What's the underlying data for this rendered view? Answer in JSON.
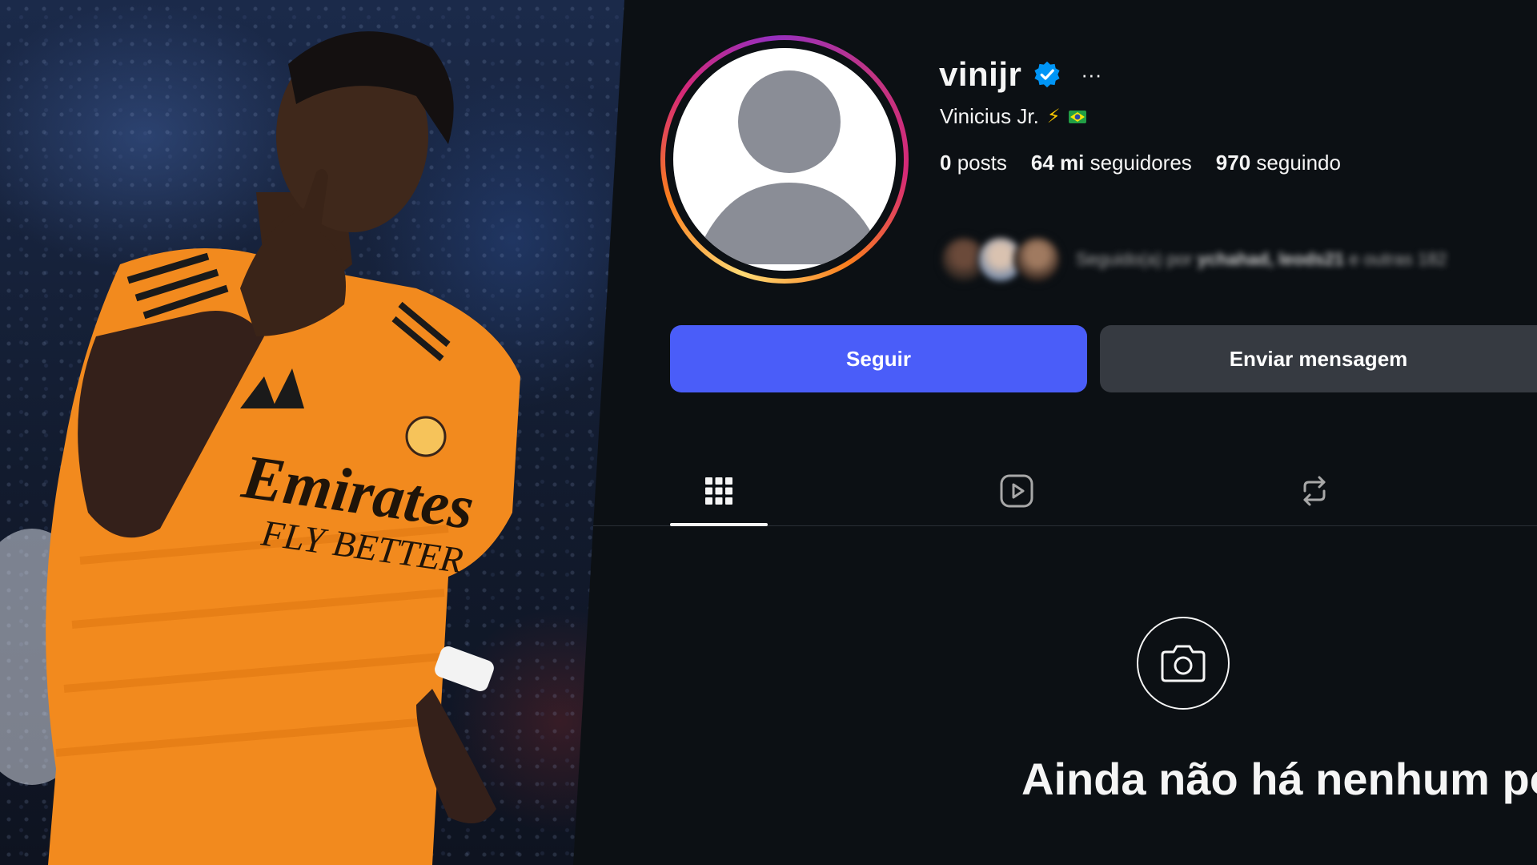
{
  "photo": {
    "icon": "player-photo",
    "shirt_sponsor_line1": "Emirates",
    "shirt_sponsor_line2": "FLY BETTER"
  },
  "profile": {
    "username": "vinijr",
    "verified_icon": "verified-badge-icon",
    "more_label": "···",
    "full_name": "Vinicius Jr.",
    "bolt_emoji": "⚡",
    "flag_icon": "brazil-flag-icon",
    "stats": {
      "posts_count": "0",
      "posts_label": "posts",
      "followers_count": "64 mi",
      "followers_label": "seguidores",
      "following_count": "970",
      "following_label": "seguindo"
    },
    "followed_by": {
      "prefix": "Seguido(a) por",
      "names": "ychahad, leods21",
      "suffix": "e outras 182"
    }
  },
  "actions": {
    "follow_label": "Seguir",
    "message_label": "Enviar mensagem"
  },
  "tabs": [
    {
      "icon": "grid-icon",
      "active": true
    },
    {
      "icon": "reels-icon",
      "active": false
    },
    {
      "icon": "repost-icon",
      "active": false
    }
  ],
  "empty_state": {
    "icon": "camera-icon",
    "title": "Ainda não há nenhum post"
  },
  "colors": {
    "background": "#0c1014",
    "follow_button": "#4a5df9",
    "message_button": "#363a41",
    "verified": "#0095f6",
    "jersey": "#f28a1e"
  }
}
